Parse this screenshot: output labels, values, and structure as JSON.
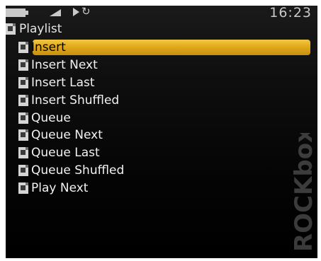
{
  "status": {
    "time": "16:23",
    "repeat_glyph": "↻"
  },
  "header": {
    "title": "Playlist"
  },
  "menu": {
    "items": [
      {
        "label": "Insert"
      },
      {
        "label": "Insert Next"
      },
      {
        "label": "Insert Last"
      },
      {
        "label": "Insert Shuffled"
      },
      {
        "label": "Queue"
      },
      {
        "label": "Queue Next"
      },
      {
        "label": "Queue Last"
      },
      {
        "label": "Queue Shuffled"
      },
      {
        "label": "Play Next"
      }
    ],
    "selected_index": 0
  },
  "watermark": {
    "text": "ROCKbox"
  },
  "colors": {
    "selection": "#e1a91c",
    "background": "#000000",
    "text": "#f2f2f2"
  }
}
